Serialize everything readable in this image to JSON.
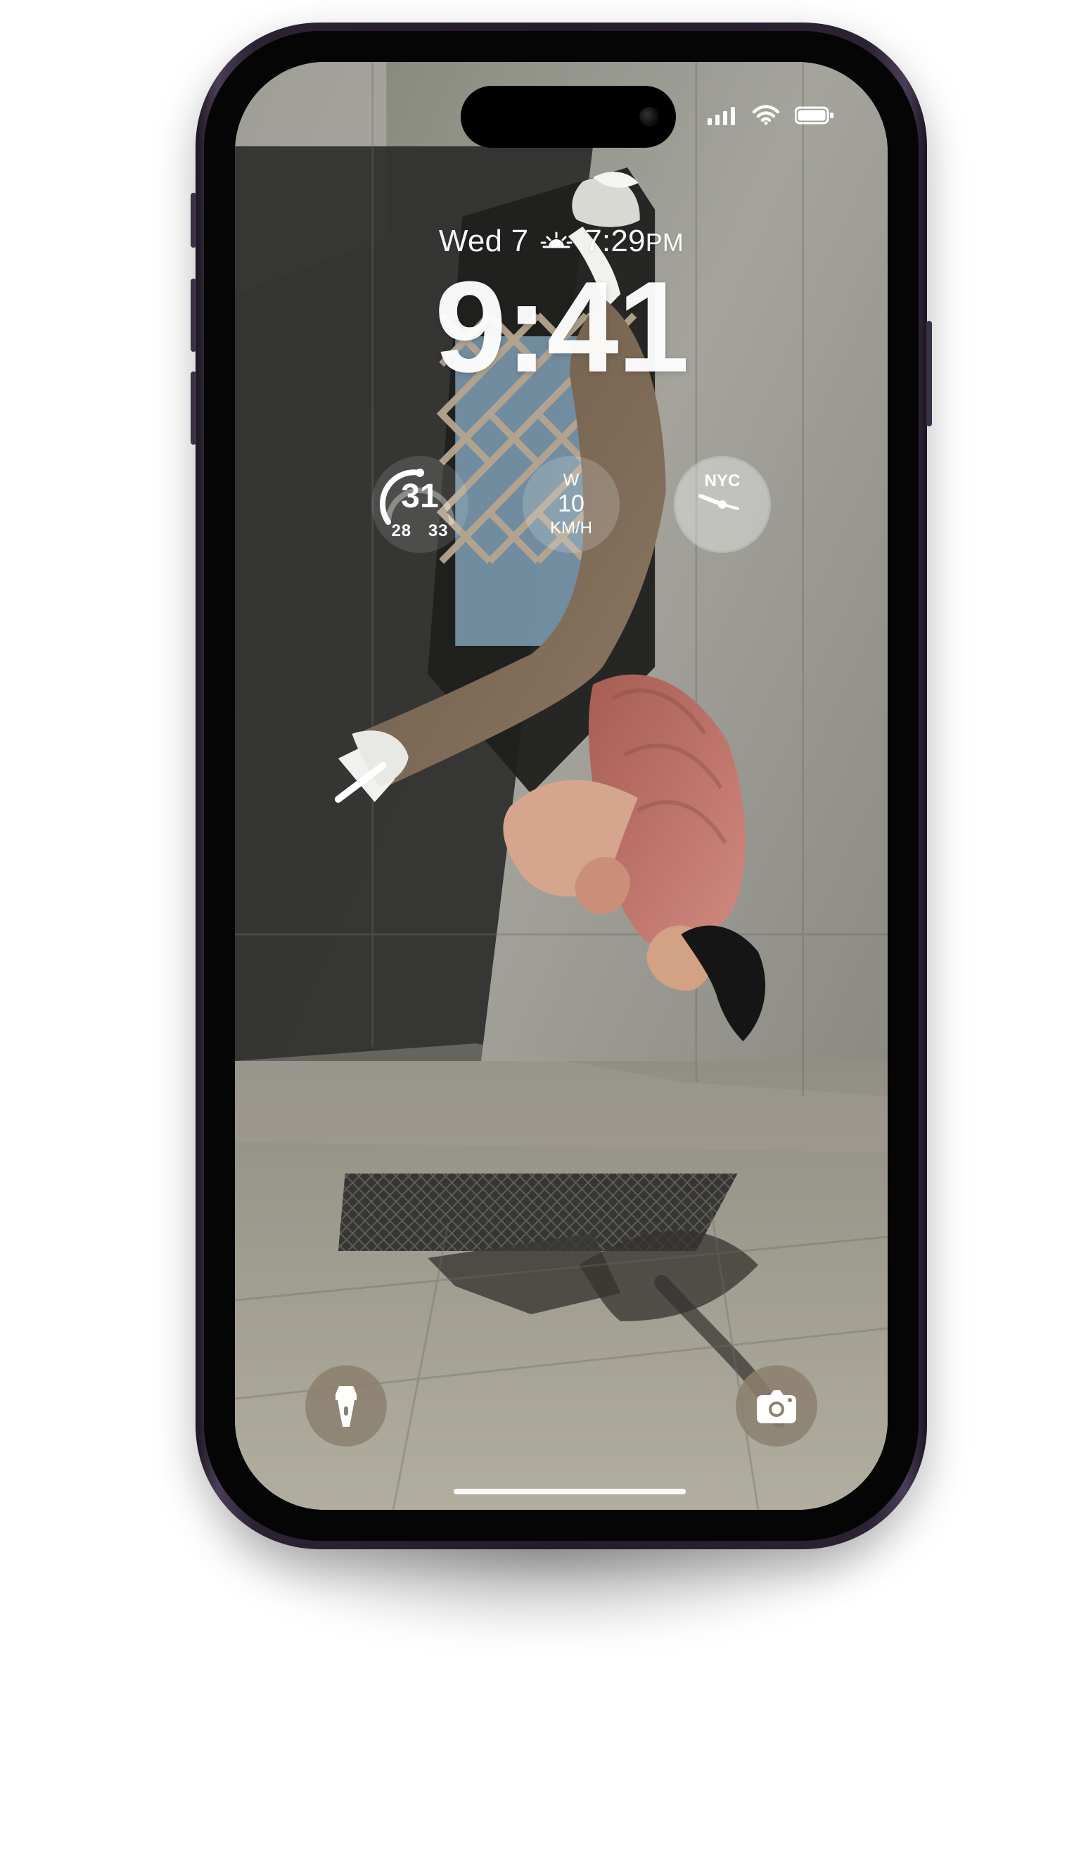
{
  "lock_screen": {
    "date": "Wed 7",
    "sunrise_time": "7:29",
    "sunrise_meridiem": "PM",
    "time": "9:41"
  },
  "widgets": {
    "temperature": {
      "current": "31",
      "low": "28",
      "high": "33"
    },
    "wind": {
      "direction": "W",
      "speed": "10",
      "unit": "KM/H"
    },
    "world_clock": {
      "city": "NYC"
    }
  },
  "controls": {
    "left": "flashlight-icon",
    "right": "camera-icon"
  },
  "status": {
    "signal_icon": "cellular-signal-icon",
    "wifi_icon": "wifi-icon",
    "battery_icon": "battery-icon"
  },
  "colors": {
    "frame": "#231c2a",
    "control_fill": "#8c806f",
    "text": "#ffffff"
  }
}
